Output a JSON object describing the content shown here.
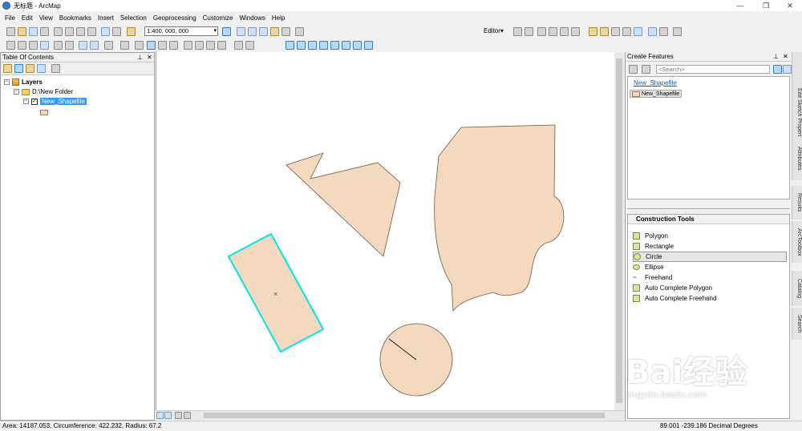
{
  "window": {
    "title": "无标题 - ArcMap"
  },
  "menu": [
    "File",
    "Edit",
    "View",
    "Bookmarks",
    "Insert",
    "Selection",
    "Geoprocessing",
    "Customize",
    "Windows",
    "Help"
  ],
  "toolbar": {
    "scale": "1:400, 000, 000",
    "editor_label": "Editor▾"
  },
  "toc": {
    "title": "Table Of Contents",
    "layers_label": "Layers",
    "folder_label": "D:\\New Folder",
    "layer_label": "New_Shapefile"
  },
  "create_features": {
    "title": "Create Features",
    "search_placeholder": "<Search>",
    "template_group": "New_Shapefile",
    "template_item": "New_Shapefile"
  },
  "construction_tools": {
    "title": "Construction Tools",
    "items": [
      "Polygon",
      "Rectangle",
      "Circle",
      "Ellipse",
      "Freehand",
      "Auto Complete Polygon",
      "Auto Complete Freehand"
    ],
    "selected": "Circle"
  },
  "side_tabs": [
    "Edit Sketch Properties",
    "Attributes",
    "Results",
    "ArcToolbox",
    "Catalog",
    "Search"
  ],
  "status": {
    "measure": "Area: 14187.053,   Circumference: 422.232,   Radius: 67.2",
    "coords": "89.001   -239.186 Decimal Degrees"
  },
  "watermark": {
    "text": "Bai经验",
    "sub": "jingyan.baidu.com"
  },
  "colors": {
    "polygon_fill": "#f5d9bf",
    "selection": "#00e5e5",
    "accent": "#3399ff"
  }
}
